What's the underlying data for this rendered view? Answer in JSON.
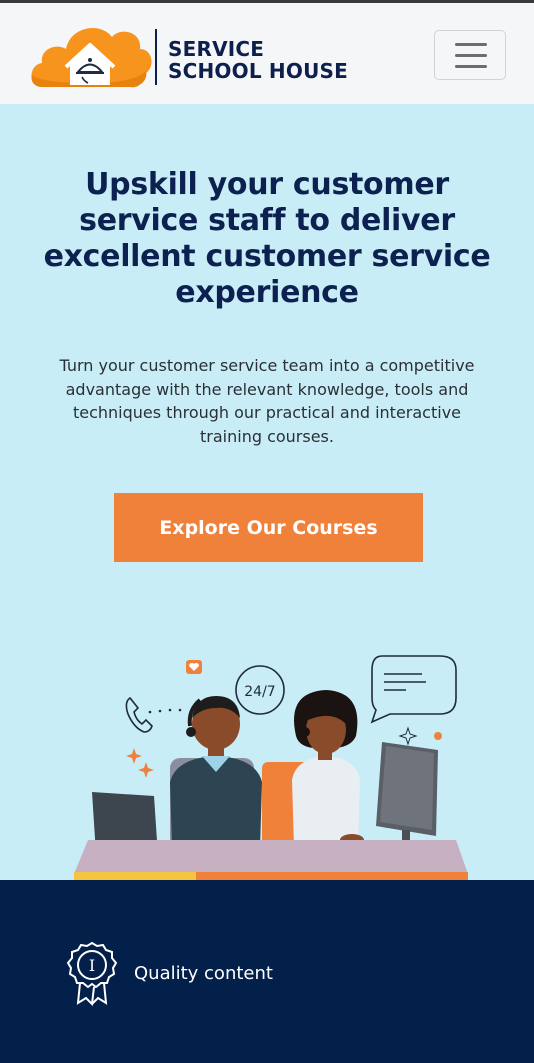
{
  "brand": {
    "line1": "SERVICE",
    "line2": "SCHOOL HOUSE",
    "logo_icon": "cloud-house-cloche-icon"
  },
  "nav": {
    "menu_icon": "hamburger-menu-icon"
  },
  "hero": {
    "headline": "Upskill your customer service staff to deliver excellent customer service experience",
    "subtext": "Turn your customer service team into a competitive advantage with the relevant knowledge, tools and techniques through our practical and interactive training courses.",
    "cta_label": "Explore Our Courses",
    "illustration": {
      "badge_text": "24/7"
    }
  },
  "features": [
    {
      "icon": "award-ribbon-icon",
      "label": "Quality content"
    }
  ],
  "colors": {
    "header_bg": "#f5f6f8",
    "hero_bg": "#c8edf6",
    "headline": "#0d2150",
    "cta_bg": "#f0813b",
    "footer_bg": "#02204a",
    "logo_orange": "#f7941d"
  }
}
